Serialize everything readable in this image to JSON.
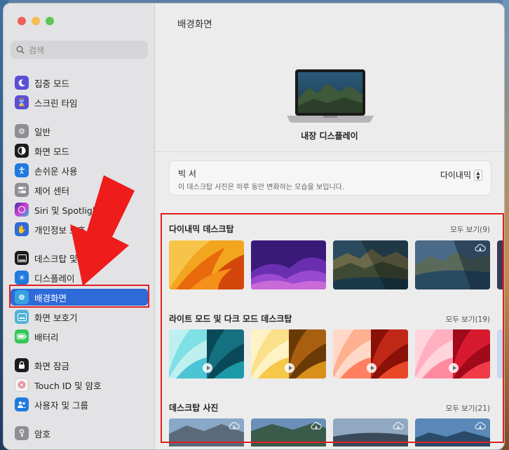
{
  "sidebar": {
    "search_placeholder": "검색",
    "items": [
      {
        "label": "집중 모드",
        "icon": "moon-icon",
        "color": "#5b4fd6"
      },
      {
        "label": "스크린 타임",
        "icon": "hourglass-icon",
        "color": "#5b4fd6"
      },
      {
        "label": "일반",
        "icon": "gear-icon",
        "color": "#8e8e93"
      },
      {
        "label": "화면 모드",
        "icon": "appearance-icon",
        "color": "#1c1c1e"
      },
      {
        "label": "손쉬운 사용",
        "icon": "accessibility-icon",
        "color": "#1f7ae0"
      },
      {
        "label": "제어 센터",
        "icon": "toggles-icon",
        "color": "#8e8e93"
      },
      {
        "label": "Siri 및 Spotlight",
        "icon": "siri-icon",
        "color": "#7a3fd1"
      },
      {
        "label": "개인정보 보호",
        "icon": "hand-icon",
        "color": "#2f6ad9"
      },
      {
        "label": "데스크탑 및 Dock",
        "icon": "dock-icon",
        "color": "#1c1c1e"
      },
      {
        "label": "디스플레이",
        "icon": "brightness-icon",
        "color": "#1f7ae0"
      },
      {
        "label": "배경화면",
        "icon": "flower-icon",
        "color": "#36a3e0"
      },
      {
        "label": "화면 보호기",
        "icon": "screensaver-icon",
        "color": "#4fb2d6"
      },
      {
        "label": "배터리",
        "icon": "battery-icon",
        "color": "#34c759"
      },
      {
        "label": "화면 잠금",
        "icon": "lock-icon",
        "color": "#1c1c1e"
      },
      {
        "label": "Touch ID 및 암호",
        "icon": "fingerprint-icon",
        "color": "#f2f2f2"
      },
      {
        "label": "사용자 및 그룹",
        "icon": "users-icon",
        "color": "#1f7ae0"
      },
      {
        "label": "암호",
        "icon": "key-icon",
        "color": "#8e8e93"
      }
    ],
    "active_index": 10
  },
  "main": {
    "title": "배경화면",
    "display_label": "내장 디스플레이",
    "info": {
      "title": "빅 서",
      "description": "이 데스크탑 사진은 하루 동안 변화하는 모습을 보입니다.",
      "mode": "다이내믹"
    },
    "sections": [
      {
        "title": "다이내믹 데스크탑",
        "more": "모두 보기(9)"
      },
      {
        "title": "라이트 모드 및 다크 모드 데스크탑",
        "more": "모두 보기(19)"
      },
      {
        "title": "데스크탑 사진",
        "more": "모두 보기(21)"
      }
    ]
  },
  "accent_color": "#2f6ad9",
  "annotation_color": "#e02020"
}
